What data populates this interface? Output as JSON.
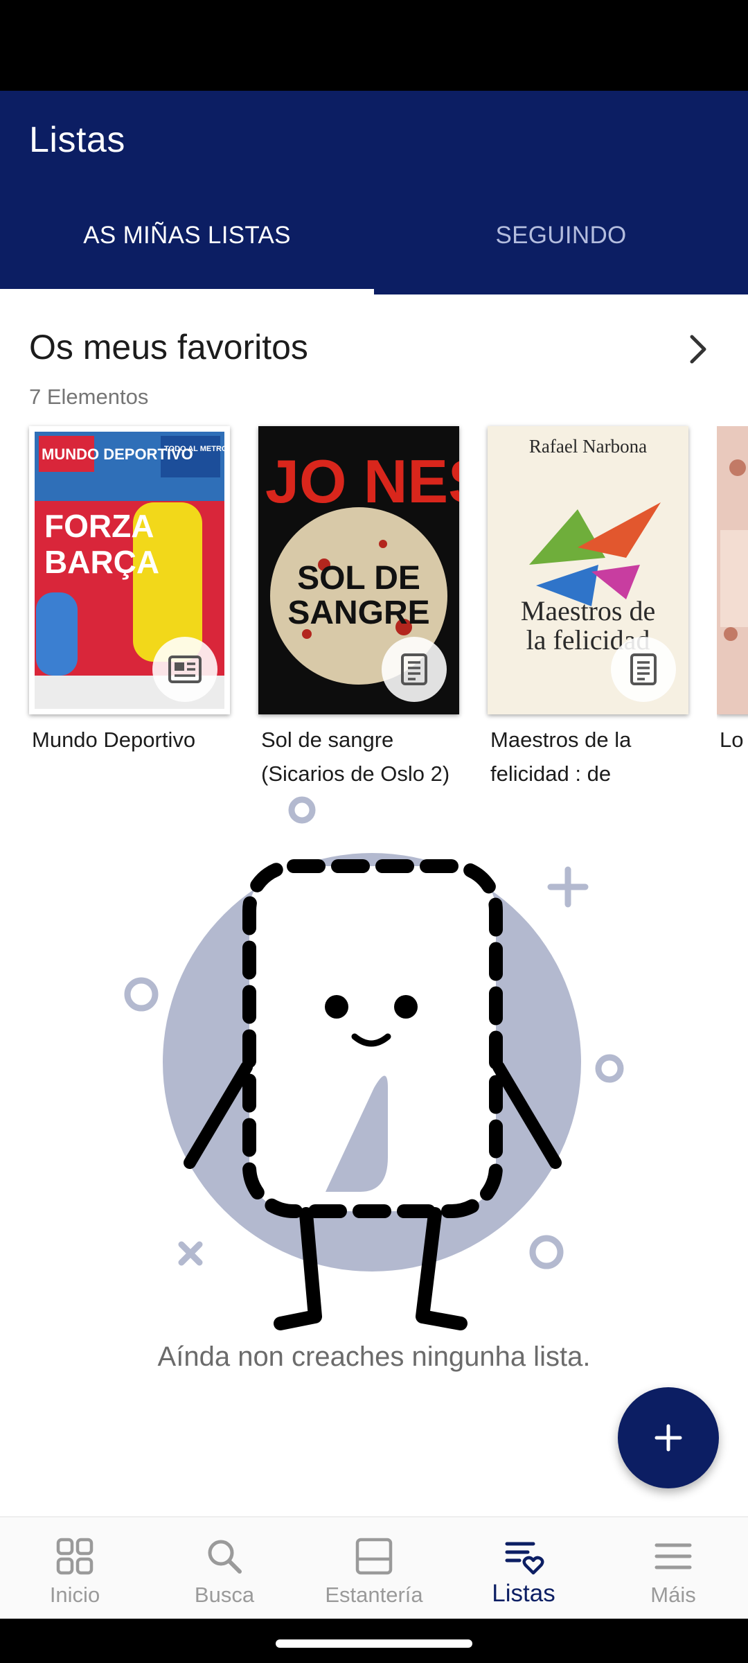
{
  "header": {
    "title": "Listas",
    "tabs": [
      {
        "label": "AS MIÑAS LISTAS",
        "active": true
      },
      {
        "label": "SEGUINDO",
        "active": false
      }
    ]
  },
  "favorites": {
    "title": "Os meus favoritos",
    "count": "7 Elementos",
    "items": [
      {
        "title": "Mundo Deportivo",
        "type_icon": "newspaper-icon",
        "cover_text": {
          "top": "MUNDO DEPORTIVO",
          "banner": "TODO AL METROPOLITANO",
          "headline_1": "FORZA",
          "headline_2": "BARÇA"
        }
      },
      {
        "title": "Sol de sangre (Sicarios de Oslo 2)",
        "type_icon": "book-icon",
        "cover_text": {
          "author": "JO NESBØ",
          "title_1": "SOL DE",
          "title_2": "SANGRE"
        }
      },
      {
        "title": "Maestros de la felicidad : de",
        "type_icon": "book-icon",
        "cover_text": {
          "author": "Rafael Narbona",
          "title_1": "Maestros de",
          "title_2": "la felicidad"
        }
      },
      {
        "title": "Lo sus",
        "type_icon": "book-icon",
        "cover_text": {}
      }
    ]
  },
  "empty_state": {
    "message": "Aínda non creaches ningunha lista."
  },
  "fab": {
    "icon": "plus-icon"
  },
  "bottom_nav": [
    {
      "label": "Inicio",
      "icon": "grid-icon",
      "active": false
    },
    {
      "label": "Busca",
      "icon": "search-icon",
      "active": false
    },
    {
      "label": "Estantería",
      "icon": "shelf-icon",
      "active": false
    },
    {
      "label": "Listas",
      "icon": "list-heart-icon",
      "active": true
    },
    {
      "label": "Máis",
      "icon": "menu-icon",
      "active": false
    }
  ],
  "colors": {
    "primary": "#0c1e63",
    "tab_inactive": "#b4bdde",
    "illustration_bg": "#b3b9cf",
    "nav_inactive": "#9a9a9a"
  }
}
